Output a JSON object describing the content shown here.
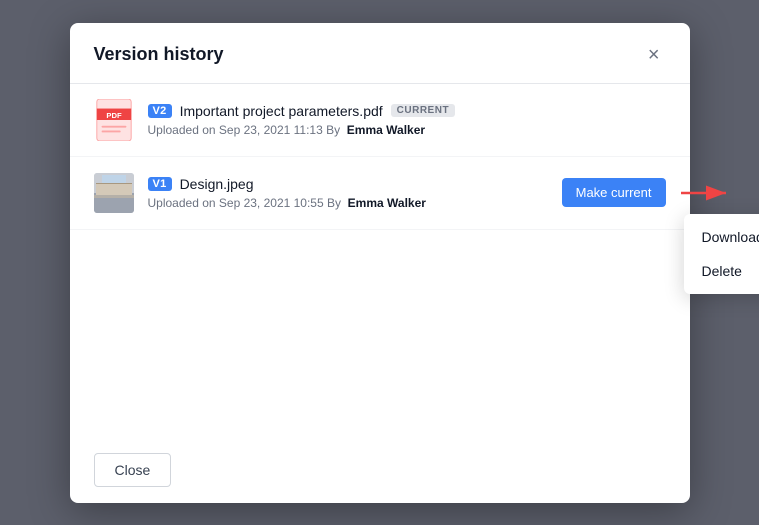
{
  "dialog": {
    "title": "Version history",
    "close_label": "×"
  },
  "versions": [
    {
      "badge": "V2",
      "filename": "Important project parameters.pdf",
      "is_current": true,
      "current_label": "CURRENT",
      "meta_uploaded": "Uploaded on Sep 23, 2021 11:13 By",
      "uploader": "Emma Walker",
      "type": "pdf"
    },
    {
      "badge": "V1",
      "filename": "Design.jpeg",
      "is_current": false,
      "meta_uploaded": "Uploaded on Sep 23, 2021 10:55 By",
      "uploader": "Emma Walker",
      "type": "jpeg"
    }
  ],
  "make_current_label": "Make current",
  "dropdown": {
    "items": [
      "Download",
      "Delete"
    ]
  },
  "footer": {
    "close_label": "Close"
  }
}
